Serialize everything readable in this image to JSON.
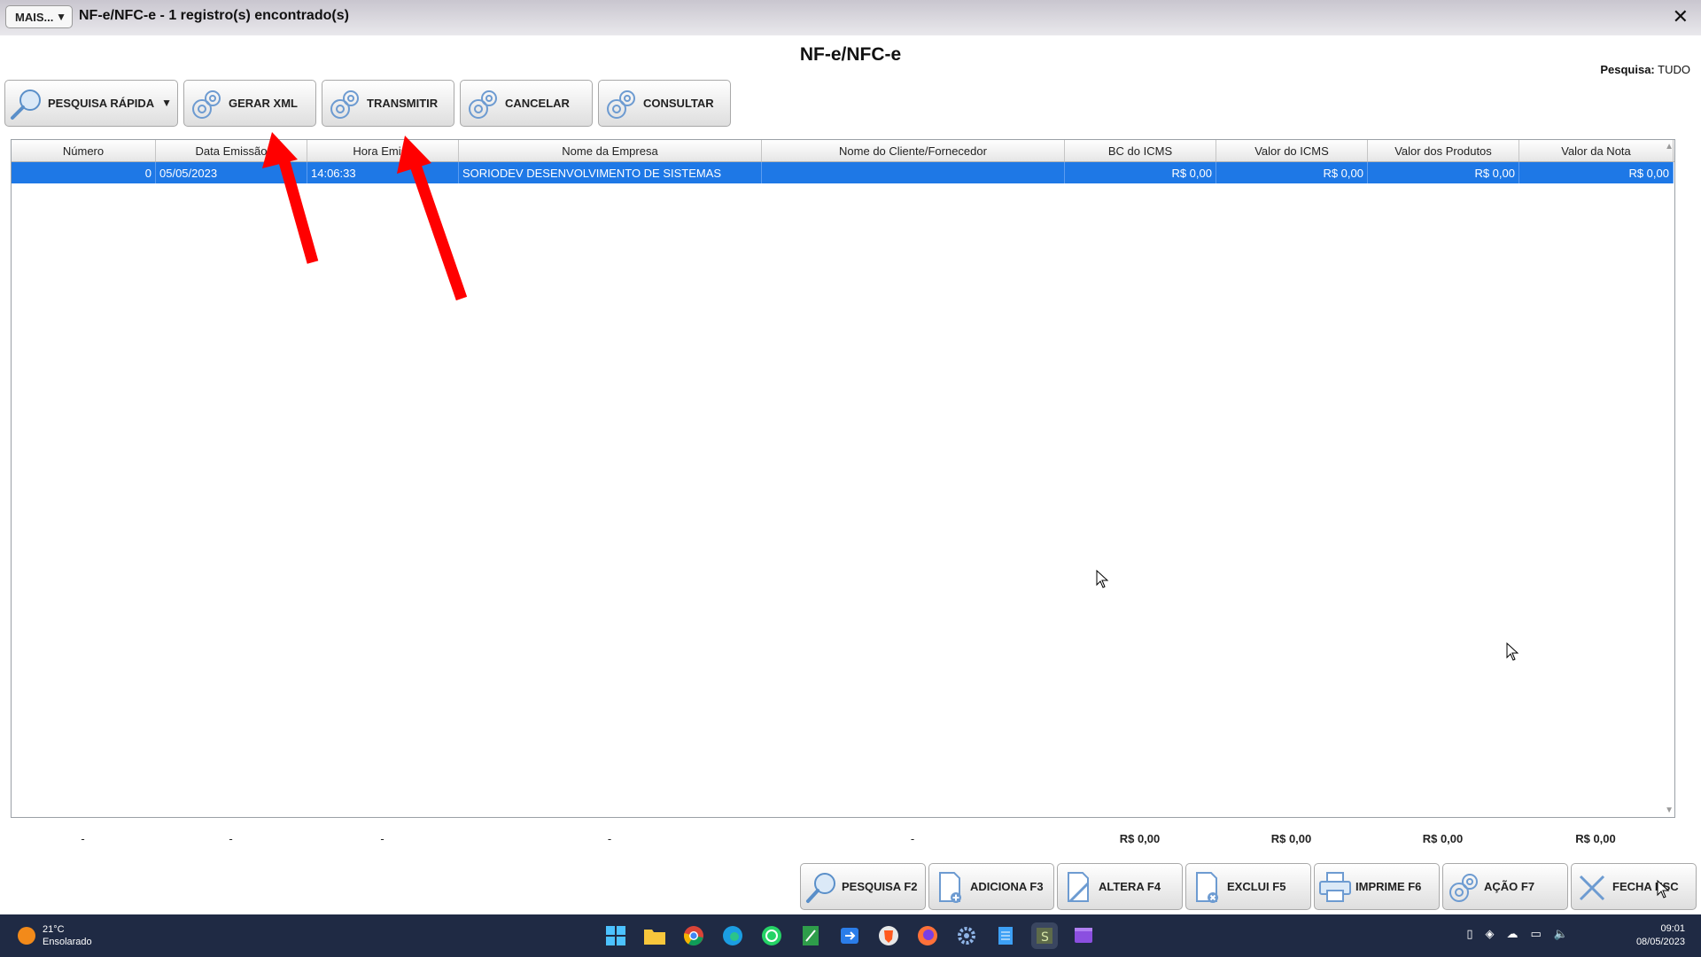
{
  "window": {
    "more_button": "MAIS...",
    "title": "NF-e/NFC-e - 1 registro(s) encontrado(s)",
    "heading": "NF-e/NFC-e",
    "search_mode_label": "Pesquisa:",
    "search_mode_value": "TUDO"
  },
  "toolbar": {
    "quick_search": "PESQUISA RÁPIDA",
    "generate_xml": "GERAR XML",
    "transmit": "TRANSMITIR",
    "cancel": "CANCELAR",
    "consult": "CONSULTAR"
  },
  "grid": {
    "columns": [
      "Número",
      "Data Emissão",
      "Hora Emiss",
      "Nome da Empresa",
      "Nome do Cliente/Fornecedor",
      "BC do ICMS",
      "Valor do ICMS",
      "Valor dos Produtos",
      "Valor da Nota"
    ],
    "rows": [
      [
        "0",
        "05/05/2023",
        "14:06:33",
        "SORIODEV DESENVOLVIMENTO DE SISTEMAS",
        "",
        "R$ 0,00",
        "R$ 0,00",
        "R$ 0,00",
        "R$ 0,00"
      ]
    ]
  },
  "totals": [
    "-",
    "-",
    "-",
    "-",
    "-",
    "R$ 0,00",
    "R$ 0,00",
    "R$ 0,00",
    "R$ 0,00"
  ],
  "actions": {
    "search": "PESQUISA F2",
    "add": "ADICIONA F3",
    "edit": "ALTERA F4",
    "delete": "EXCLUI F5",
    "print": "IMPRIME F6",
    "action": "AÇÃO F7",
    "close": "FECHA ESC"
  },
  "taskbar": {
    "temperature": "21°C",
    "weather": "Ensolarado",
    "time": "09:01",
    "date": "08/05/2023"
  },
  "colors": {
    "selection": "#1e78e6",
    "annotation_arrow": "#ff0000"
  }
}
